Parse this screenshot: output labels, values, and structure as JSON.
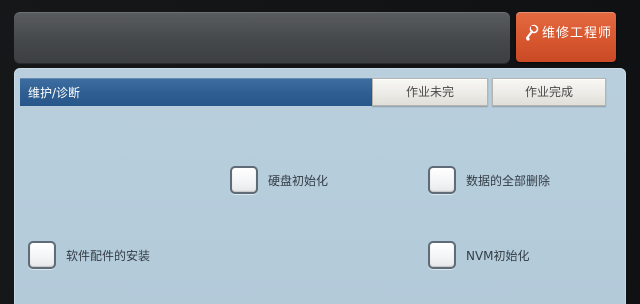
{
  "header": {
    "mode_button_label": "维修工程师",
    "mode_icon": "wrench-icon"
  },
  "panel": {
    "title": "维护/诊断",
    "tabs": {
      "unfinished": "作业未完",
      "finished": "作业完成"
    }
  },
  "options": {
    "hdd_init": "硬盘初始化",
    "delete_all_data": "数据的全部删除",
    "software_install": "软件配件的安装",
    "nvm_init": "NVM初始化"
  },
  "colors": {
    "accent_orange": "#d8572f",
    "header_blue": "#2f5f93",
    "panel_bg": "#b7cedd"
  }
}
